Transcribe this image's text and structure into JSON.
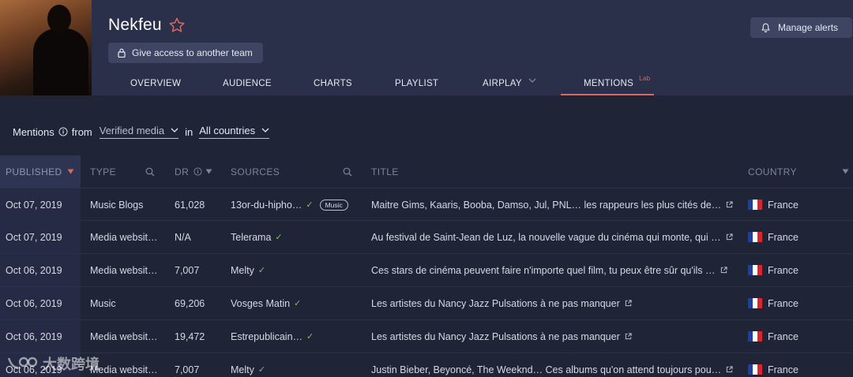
{
  "artist": {
    "name": "Nekfeu"
  },
  "header": {
    "access_button": "Give access to another team",
    "manage_alerts": "Manage alerts"
  },
  "tabs": [
    {
      "label": "OVERVIEW"
    },
    {
      "label": "AUDIENCE"
    },
    {
      "label": "CHARTS"
    },
    {
      "label": "PLAYLIST"
    },
    {
      "label": "AIRPLAY"
    },
    {
      "label": "MENTIONS",
      "badge": "Lab",
      "active": true
    }
  ],
  "filter": {
    "mentions_label": "Mentions",
    "from_label": "from",
    "source_value": "Verified media",
    "in_label": "in",
    "country_value": "All countries"
  },
  "columns": {
    "published": "PUBLISHED",
    "type": "TYPE",
    "dr": "DR",
    "sources": "SOURCES",
    "title": "TITLE",
    "country": "COUNTRY"
  },
  "rows": [
    {
      "date": "Oct 07, 2019",
      "type": "Music Blogs",
      "dr": "61,028",
      "source": "13or-du-hipho…",
      "badge": "Music",
      "title": "Maitre Gims, Kaaris, Booba, Damso, Jul, PNL… les rappeurs les plus cités de…",
      "country": "France"
    },
    {
      "date": "Oct 07, 2019",
      "type": "Media websit…",
      "dr": "N/A",
      "source": "Telerama",
      "badge": "",
      "title": "Au festival de Saint-Jean de Luz, la nouvelle vague du cinéma qui monte, qui …",
      "country": "France"
    },
    {
      "date": "Oct 06, 2019",
      "type": "Media websit…",
      "dr": "7,007",
      "source": "Melty",
      "badge": "",
      "title": "Ces stars de cinéma peuvent faire n'importe quel film, tu peux être sûr qu'ils …",
      "country": "France"
    },
    {
      "date": "Oct 06, 2019",
      "type": "Music",
      "dr": "69,206",
      "source": "Vosges Matin",
      "badge": "",
      "title": "Les artistes du Nancy Jazz Pulsations à ne pas manquer",
      "country": "France"
    },
    {
      "date": "Oct 06, 2019",
      "type": "Media websit…",
      "dr": "19,472",
      "source": "Estrepublicain…",
      "badge": "",
      "title": "Les artistes du Nancy Jazz Pulsations à ne pas manquer",
      "country": "France"
    },
    {
      "date": "Oct 06, 2019",
      "type": "Media websit…",
      "dr": "7,007",
      "source": "Melty",
      "badge": "",
      "title": "Justin Bieber, Beyoncé, The Weeknd… Ces albums qu'on attend toujours pou…",
      "country": "France"
    }
  ],
  "watermark": "大数跨境",
  "colors": {
    "accent": "#e0685a",
    "check": "#7fbf6a",
    "header_bg": "#2a304a",
    "page_bg": "#1f2437"
  }
}
